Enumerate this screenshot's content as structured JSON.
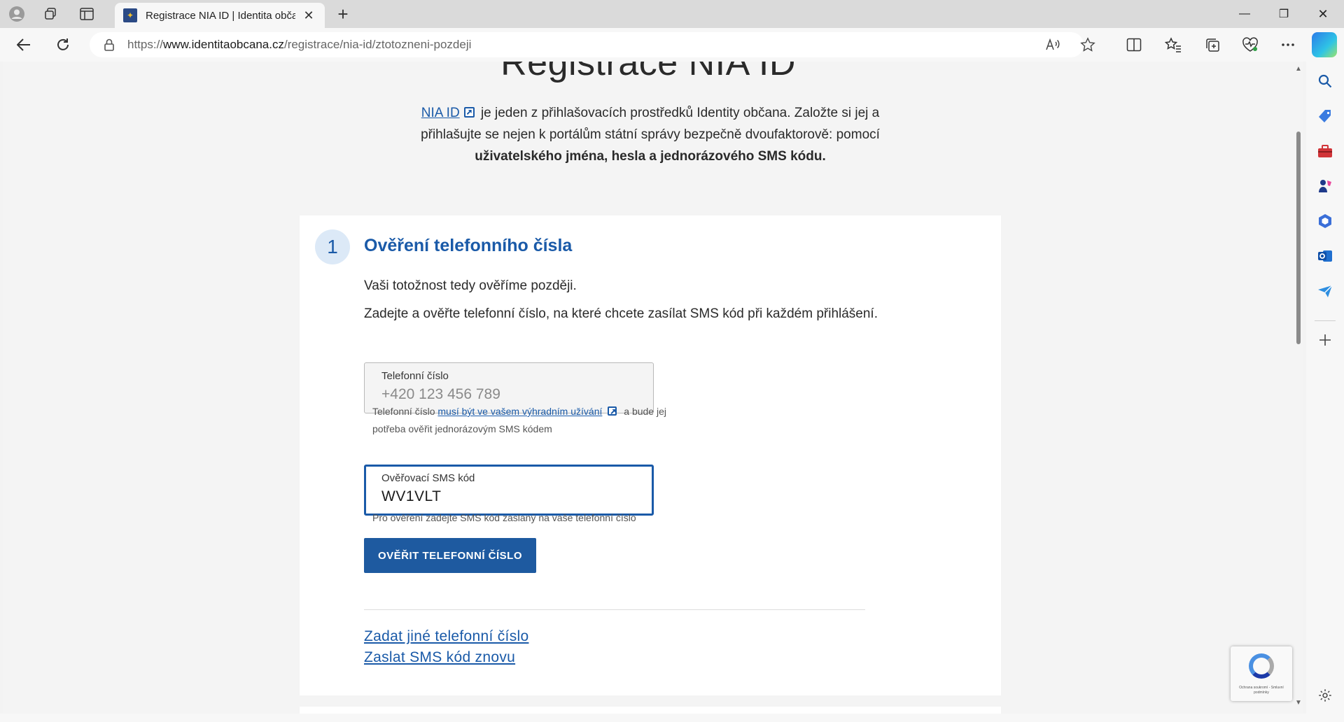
{
  "browser": {
    "tab": {
      "title": "Registrace NIA ID | Identita občana",
      "close": "✕"
    },
    "new_tab": "+",
    "window": {
      "minimize": "—",
      "restore": "❐",
      "close": "✕"
    },
    "url": {
      "prefix": "https://",
      "host": "www.identitaobcana.cz",
      "path": "/registrace/nia-id/ztotozneni-pozdeji"
    }
  },
  "page": {
    "title": "Registrace NIA ID",
    "intro": {
      "link": "NIA ID",
      "text1": " je jeden z přihlašovacích prostředků Identity občana. Založte si jej a přihlašujte se nejen k portálům státní správy bezpečně dvoufaktorově: pomocí ",
      "bold": "uživatelského jména, hesla a jednorázového SMS kódu."
    },
    "step": {
      "number": "1",
      "title": "Ověření telefonního čísla",
      "p1": "Vaši totožnost tedy ověříme později.",
      "p2": "Zadejte a ověřte telefonní číslo, na které chcete zasílat SMS kód při každém přihlášení.",
      "phone": {
        "label": "Telefonní číslo",
        "placeholder": "+420 123 456 789",
        "hint_pre": "Telefonní číslo ",
        "hint_link": "musí být ve vašem výhradním užívání",
        "hint_post": " a bude jej potřeba ověřit jednorázovým SMS kódem"
      },
      "sms": {
        "label": "Ověřovací SMS kód",
        "value": "WV1VLT",
        "hint": "Pro ověření zadejte SMS kód zaslaný na vaše telefonní číslo"
      },
      "verify_button": "OVĚŘIT TELEFONNÍ ČÍSLO",
      "link_other_number": "Zadat jiné telefonní číslo",
      "link_resend": "Zaslat SMS kód znovu"
    },
    "recaptcha_text": "Ochrana soukromí - Smluvní podmínky"
  },
  "colors": {
    "accent": "#1a5aa8",
    "button": "#1e5aa0",
    "step_circle": "#dce9f7"
  }
}
